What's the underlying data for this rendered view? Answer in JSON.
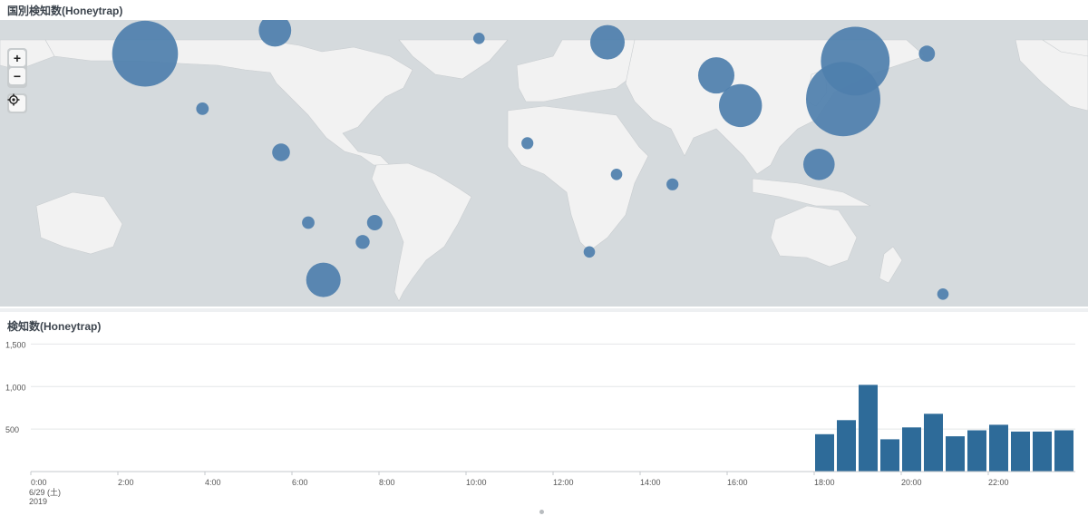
{
  "map_panel": {
    "title": "国別検知数(Honeytrap)",
    "zoom_in_label": "+",
    "zoom_out_label": "−",
    "bubble_color": "#4e7fad",
    "bubbles": [
      {
        "name": "usa-west",
        "lon": -119,
        "lat": 36,
        "value": 330
      },
      {
        "name": "china",
        "lon": 112,
        "lat": 23,
        "value": 420
      },
      {
        "name": "china-east",
        "lon": 116,
        "lat": 34,
        "value": 360
      },
      {
        "name": "russia-west",
        "lon": 38,
        "lat": 56,
        "value": 340
      },
      {
        "name": "india",
        "lon": 78,
        "lat": 21,
        "value": 140
      },
      {
        "name": "pakistan",
        "lon": 70,
        "lat": 30,
        "value": 100
      },
      {
        "name": "usa-east",
        "lon": -76,
        "lat": 42,
        "value": 80
      },
      {
        "name": "turkey",
        "lon": 34,
        "lat": 39,
        "value": 90
      },
      {
        "name": "argentina",
        "lon": -60,
        "lat": -34,
        "value": 90
      },
      {
        "name": "singapore",
        "lon": 104,
        "lat": 2,
        "value": 75
      },
      {
        "name": "japan",
        "lon": 139.7,
        "lat": 36,
        "value": 20
      },
      {
        "name": "russia-east",
        "lon": 83,
        "lat": 57,
        "value": 25
      },
      {
        "name": "mongolia",
        "lon": 106,
        "lat": 48,
        "value": 12
      },
      {
        "name": "uk",
        "lon": -2,
        "lat": 54,
        "value": 20
      },
      {
        "name": "canada-west",
        "lon": -123,
        "lat": 49,
        "value": 14
      },
      {
        "name": "mexico",
        "lon": -100,
        "lat": 20,
        "value": 12
      },
      {
        "name": "colombia",
        "lon": -74,
        "lat": 6,
        "value": 24
      },
      {
        "name": "brazil-north",
        "lon": -43,
        "lat": -17,
        "value": 18
      },
      {
        "name": "brazil-south",
        "lon": -47,
        "lat": -23,
        "value": 15
      },
      {
        "name": "bolivia",
        "lon": -65,
        "lat": -17,
        "value": 12
      },
      {
        "name": "portugal",
        "lon": -8.5,
        "lat": 40,
        "value": 10
      },
      {
        "name": "nigeria",
        "lon": 7.5,
        "lat": 9,
        "value": 11
      },
      {
        "name": "kenya",
        "lon": 37,
        "lat": -1.3,
        "value": 10
      },
      {
        "name": "seychelles",
        "lon": 55.5,
        "lat": -4.6,
        "value": 11
      },
      {
        "name": "south-africa",
        "lon": 28,
        "lat": -26,
        "value": 10
      },
      {
        "name": "australia",
        "lon": 145,
        "lat": -37.8,
        "value": 10
      }
    ]
  },
  "chart_panel": {
    "title": "検知数(Honeytrap)",
    "chart_data": {
      "type": "bar",
      "ylim": [
        0,
        1600
      ],
      "yticks": [
        500,
        1000,
        1500
      ],
      "ytick_labels": [
        "500",
        "1,000",
        "1,500"
      ],
      "xlim_hours": [
        0,
        24
      ],
      "xticks": [
        0,
        2,
        4,
        6,
        8,
        10,
        12,
        14,
        16,
        18,
        20,
        22
      ],
      "xtick_labels": [
        "0:00",
        "2:00",
        "4:00",
        "6:00",
        "8:00",
        "10:00",
        "12:00",
        "14:00",
        "16:00",
        "18:00",
        "20:00",
        "22:00"
      ],
      "date_label": "6/29 (土)",
      "year_label": "2019",
      "bar_hours": [
        18,
        18.5,
        19,
        19.5,
        20,
        20.5,
        21,
        21.5,
        22,
        22.5,
        23,
        23.5
      ],
      "values": [
        440,
        605,
        1020,
        380,
        520,
        680,
        415,
        485,
        550,
        470,
        470,
        485
      ],
      "bar_color": "#2e6b99"
    }
  }
}
